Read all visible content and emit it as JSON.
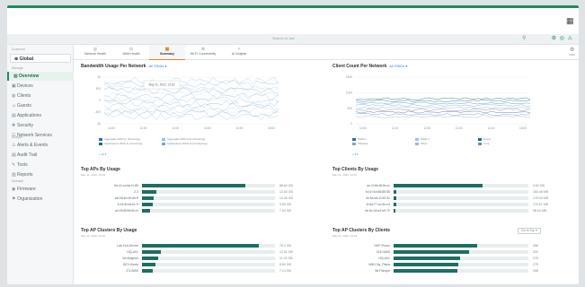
{
  "header": {
    "grid_icon": "apps-grid-icon"
  },
  "search": {
    "placeholder": "Search or ask",
    "right_icons": "⚙ ◎ ⚠"
  },
  "sidebar": {
    "customer_caption": "Customer",
    "site": "Global",
    "manage_caption": "Manage",
    "items": [
      {
        "label": "Overview",
        "icon": "▦",
        "active": true
      },
      {
        "label": "Devices",
        "icon": "▣"
      },
      {
        "label": "Clients",
        "icon": "◍"
      },
      {
        "label": "Guests",
        "icon": "☺"
      },
      {
        "label": "Applications",
        "icon": "▤"
      },
      {
        "label": "Security",
        "icon": "✚"
      },
      {
        "label": "Network Services",
        "icon": "☷"
      }
    ],
    "analyze_caption": "Analyze",
    "analyze_items": [
      {
        "label": "Alerts & Events",
        "icon": "⚠"
      },
      {
        "label": "Audit Trail",
        "icon": "▤"
      },
      {
        "label": "Tools",
        "icon": "✎"
      },
      {
        "label": "Reports",
        "icon": "▥"
      }
    ],
    "maintain_caption": "Maintain",
    "maintain_items": [
      {
        "label": "Firmware",
        "icon": "◉"
      },
      {
        "label": "Organization",
        "icon": "⚑"
      }
    ]
  },
  "tabs": [
    {
      "label": "Network Health",
      "icon": "◎"
    },
    {
      "label": "WAN Health",
      "icon": "⊙"
    },
    {
      "label": "Summary",
      "icon": "▣",
      "active": true
    },
    {
      "label": "Wi-Fi Connectivity",
      "icon": "⊚"
    },
    {
      "label": "AI Insights",
      "icon": "✧"
    }
  ],
  "filter": {
    "icon": "filter-icon",
    "label": "Filter"
  },
  "bandwidth": {
    "title": "Bandwidth Usage Per Network",
    "selector": "All SSIDs ▾",
    "y_ticks": [
      "1k",
      "500",
      "0",
      "-500",
      "-1k"
    ],
    "x_ticks": [
      "10:00",
      "11:00",
      "12:00",
      "13:00",
      "14:00",
      "15:00"
    ],
    "tooltip": "May 11, 2022, 13:30",
    "legend": [
      "Aggregate WAN In (Incoming)",
      "Aggregate WAN Out (Outgoing)",
      "Applications WAN In (Incoming)",
      "Applications WAN Out (Outgoing)"
    ],
    "more": "+ 12 ▾"
  },
  "client_count": {
    "title": "Client Count Per Network",
    "selector": "All SSIDs ▾",
    "y_ticks": [
      "1500",
      "1000",
      "500",
      "0"
    ],
    "x_ticks": [
      "10:00",
      "11:00",
      "12:00",
      "13:00",
      "14:00",
      "15:00"
    ],
    "legend": [
      "SSID-1",
      "SSID-2",
      "Guest",
      "Wireless",
      "Other",
      "Corp"
    ],
    "more": "+ 5 ▾"
  },
  "top_aps": {
    "title": "Top APs By Usage",
    "subtitle": "May 11, 2022, 13:15",
    "rows": [
      {
        "label": "bb:41:cc:6a:f1:80",
        "value": 0.78,
        "text": "88.64 GB"
      },
      {
        "label": "2.3",
        "value": 0.11,
        "text": "12.63 GB"
      },
      {
        "label": "a8:28:4b:d0:6e:ff",
        "value": 0.09,
        "text": "10.28 GB"
      },
      {
        "label": "5.26:4f:b6:fd:7f",
        "value": 0.08,
        "text": "9.65 GB"
      },
      {
        "label": "a4:26:8f:59:6f:c0",
        "value": 0.06,
        "text": "7.54 GB"
      }
    ]
  },
  "top_clients": {
    "title": "Top Clients By Usage",
    "subtitle": "May 11, 2022, 13:15",
    "rows": [
      {
        "label": "ac:1f:6b:f8:9e:cc",
        "value": 0.66,
        "text": "4.63 GB"
      },
      {
        "label": "b4:1f:4d:88:85:55",
        "value": 0.02,
        "text": "180.48 MB"
      },
      {
        "label": "2e:6b:a4:1f:d0:3c",
        "value": 0.02,
        "text": "175.94 MB"
      },
      {
        "label": "1f:da:77:cc:5e:e4",
        "value": 0.02,
        "text": "170.57 MB"
      },
      {
        "label": "4e:5c:18:a2:b9:70",
        "value": 0.01,
        "text": "98.64 MB"
      }
    ]
  },
  "top_ap_clusters": {
    "title": "Top AP Clusters By Usage",
    "subtitle": "May 11, 2022, 13:15",
    "rows": [
      {
        "label": "Lab-Full-Server",
        "value": 0.88,
        "text": "78.3 GB"
      },
      {
        "label": "HQ-A01",
        "value": 0.14,
        "text": "12.51 GB"
      },
      {
        "label": "Wi-Magnus",
        "value": 0.12,
        "text": "11.02 GB"
      },
      {
        "label": "DEV-Kyoto",
        "value": 0.1,
        "text": "8.84 GB"
      },
      {
        "label": "2'3-WAS",
        "value": 0.08,
        "text": "7.14 GB"
      }
    ]
  },
  "top_ap_clusters_clients": {
    "title": "Top AP Clusters By Clients",
    "subtitle": "May 11, 2022, 13:15",
    "button": "Go to Top ▾",
    "rows": [
      {
        "label": "HKP-Pomo",
        "value": 0.62,
        "text": "355"
      },
      {
        "label": "21E-WAS",
        "value": 0.56,
        "text": "320"
      },
      {
        "label": "HQ-A01",
        "value": 0.49,
        "text": "279"
      },
      {
        "label": "Wifi-City_Plaza",
        "value": 0.48,
        "text": "275"
      },
      {
        "label": "Wi-Flarspe",
        "value": 0.47,
        "text": "268"
      }
    ]
  },
  "colors": {
    "accent": "#1f8a5e",
    "bar": "#1e6e63",
    "tab_active": "#e67e22",
    "link": "#3b7ac2"
  }
}
